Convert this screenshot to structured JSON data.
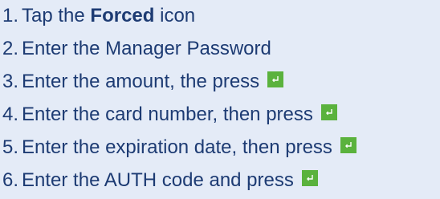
{
  "steps": [
    {
      "number": "1.",
      "before": "Tap the",
      "bold": "Forced",
      "after": "icon"
    },
    {
      "number": "2.",
      "text": "Enter the Manager Password"
    },
    {
      "number": "3.",
      "text": "Enter the amount, the press",
      "key_icon": "enter-key-icon"
    },
    {
      "number": "4.",
      "text": "Enter the card number, then press",
      "key_icon": "enter-key-icon"
    },
    {
      "number": "5.",
      "text": "Enter the expiration date, then press",
      "key_icon": "enter-key-icon"
    },
    {
      "number": "6.",
      "text": "Enter the AUTH code and press",
      "key_icon": "enter-key-icon"
    }
  ],
  "colors": {
    "background": "#e4ebf7",
    "text": "#1d3b73",
    "enter_key": "#5ab23d"
  }
}
